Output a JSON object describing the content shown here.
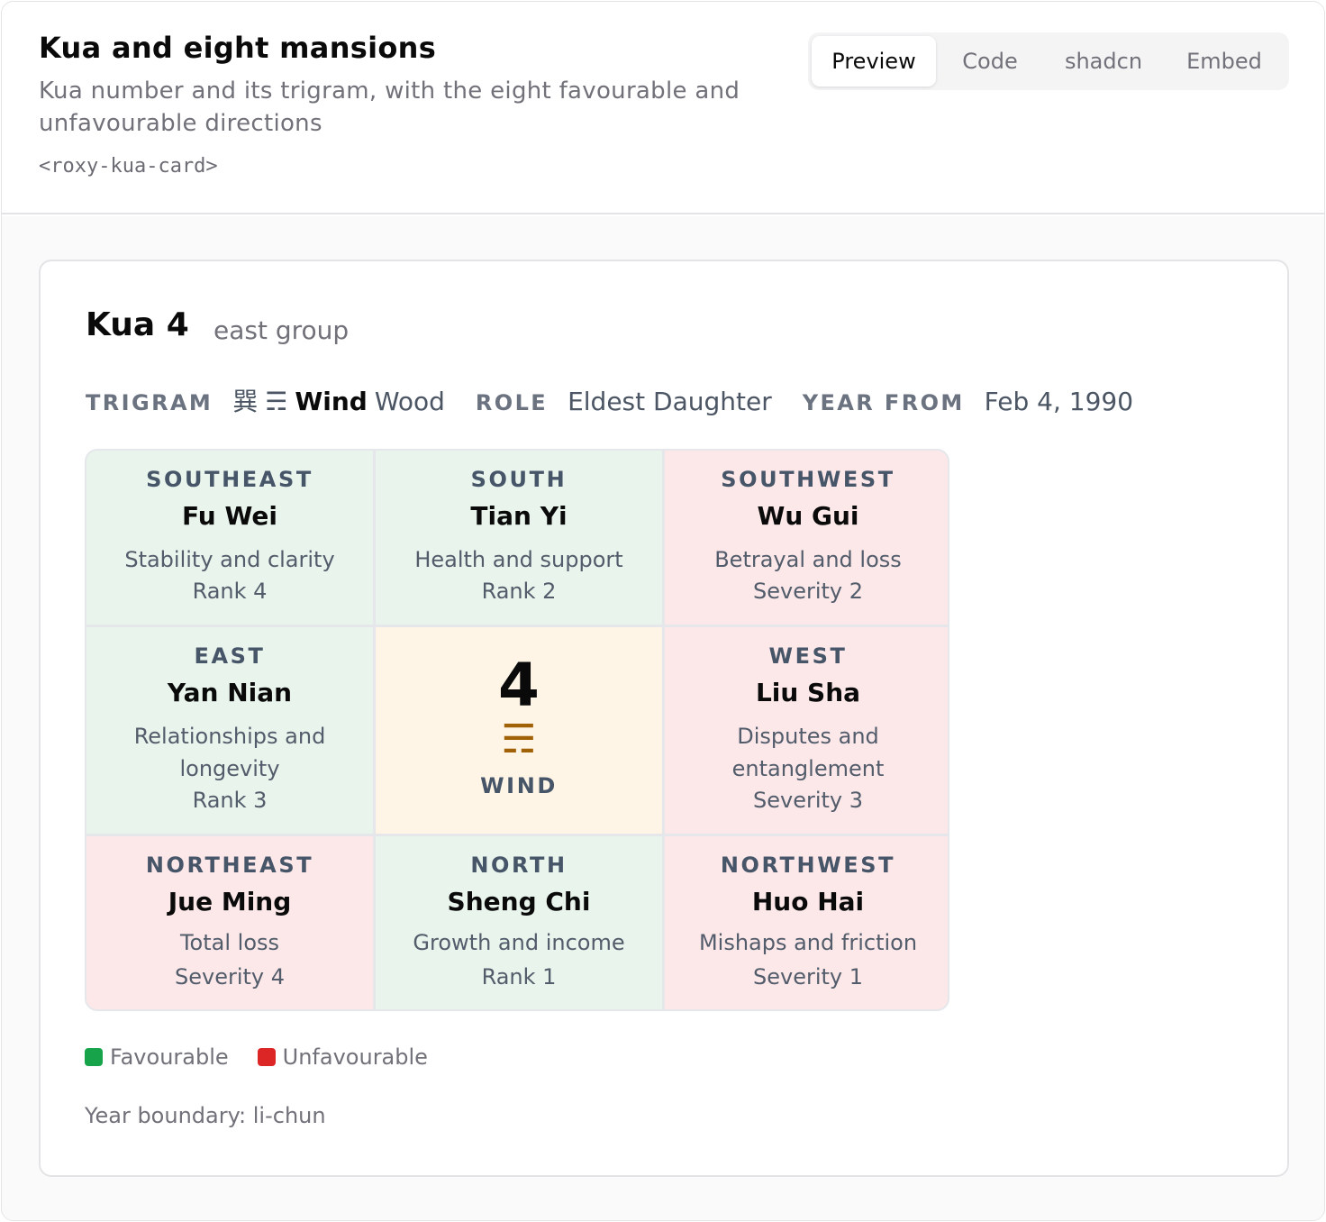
{
  "header": {
    "title": "Kua and eight mansions",
    "description": "Kua number and its trigram, with the eight favourable and unfavourable directions",
    "tag": "<roxy-kua-card>",
    "tabs": [
      "Preview",
      "Code",
      "shadcn",
      "Embed"
    ],
    "active_tab": "Preview"
  },
  "card": {
    "kua_title": "Kua 4",
    "group": "east group",
    "trigram_label": "TRIGRAM",
    "trigram_char": "巽",
    "trigram_symbol": "☴",
    "trigram_name": "Wind",
    "trigram_element": "Wood",
    "role_label": "ROLE",
    "role_value": "Eldest Daughter",
    "year_label": "YEAR FROM",
    "year_value": "Feb 4, 1990",
    "cells": [
      {
        "direction": "SOUTHEAST",
        "name": "Fu Wei",
        "meaning": "Stability and clarity",
        "stat": "Rank 4",
        "type": "fav"
      },
      {
        "direction": "SOUTH",
        "name": "Tian Yi",
        "meaning": "Health and support",
        "stat": "Rank 2",
        "type": "fav"
      },
      {
        "direction": "SOUTHWEST",
        "name": "Wu Gui",
        "meaning": "Betrayal and loss",
        "stat": "Severity 2",
        "type": "unf"
      },
      {
        "direction": "EAST",
        "name": "Yan Nian",
        "meaning": "Relationships and longevity",
        "stat": "Rank 3",
        "type": "fav"
      },
      {
        "number": "4",
        "symbol": "☴",
        "label": "WIND",
        "type": "center"
      },
      {
        "direction": "WEST",
        "name": "Liu Sha",
        "meaning": "Disputes and entanglement",
        "stat": "Severity 3",
        "type": "unf"
      },
      {
        "direction": "NORTHEAST",
        "name": "Jue Ming",
        "meaning": "Total loss",
        "stat": "Severity 4",
        "type": "unf"
      },
      {
        "direction": "NORTH",
        "name": "Sheng Chi",
        "meaning": "Growth and income",
        "stat": "Rank 1",
        "type": "fav"
      },
      {
        "direction": "NORTHWEST",
        "name": "Huo Hai",
        "meaning": "Mishaps and friction",
        "stat": "Severity 1",
        "type": "unf"
      }
    ],
    "legend": {
      "favourable": "Favourable",
      "unfavourable": "Unfavourable",
      "favourable_color": "#16a34a",
      "unfavourable_color": "#dc2626"
    },
    "year_boundary": "Year boundary: li-chun"
  }
}
